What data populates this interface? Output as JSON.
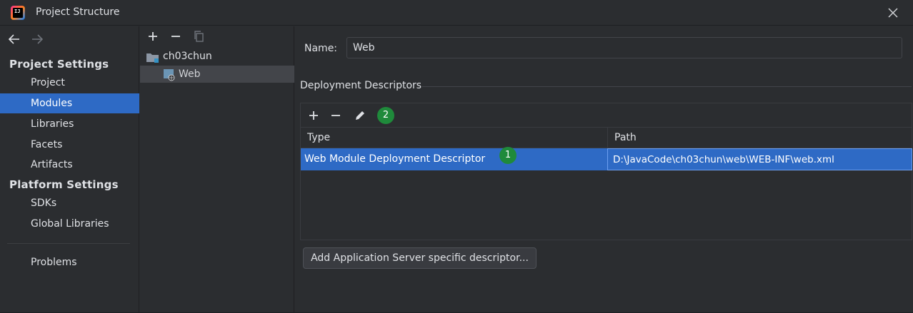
{
  "window": {
    "title": "Project Structure",
    "logo_text": "IJ"
  },
  "nav": {
    "project_settings_header": "Project Settings",
    "project_settings_items": [
      {
        "label": "Project"
      },
      {
        "label": "Modules",
        "selected": true
      },
      {
        "label": "Libraries"
      },
      {
        "label": "Facets"
      },
      {
        "label": "Artifacts"
      }
    ],
    "platform_settings_header": "Platform Settings",
    "platform_settings_items": [
      {
        "label": "SDKs"
      },
      {
        "label": "Global Libraries"
      }
    ],
    "problems_label": "Problems"
  },
  "tree": {
    "items": [
      {
        "label": "ch03chun",
        "icon": "module-folder-icon"
      },
      {
        "label": "Web",
        "icon": "web-facet-icon",
        "selected": true
      }
    ]
  },
  "content": {
    "name_label": "Name:",
    "name_value": "Web",
    "section_title": "Deployment Descriptors",
    "table": {
      "columns": [
        "Type",
        "Path"
      ],
      "rows": [
        {
          "type": "Web Module Deployment Descriptor",
          "path": "D:\\JavaCode\\ch03chun\\web\\WEB-INF\\web.xml"
        }
      ]
    },
    "badges": {
      "row_badge": "1",
      "edit_badge": "2"
    },
    "add_button_label": "Add Application Server specific descriptor..."
  },
  "colors": {
    "background": "#2b2d30",
    "selection": "#2e6ac5",
    "badge": "#1f8a3b"
  }
}
